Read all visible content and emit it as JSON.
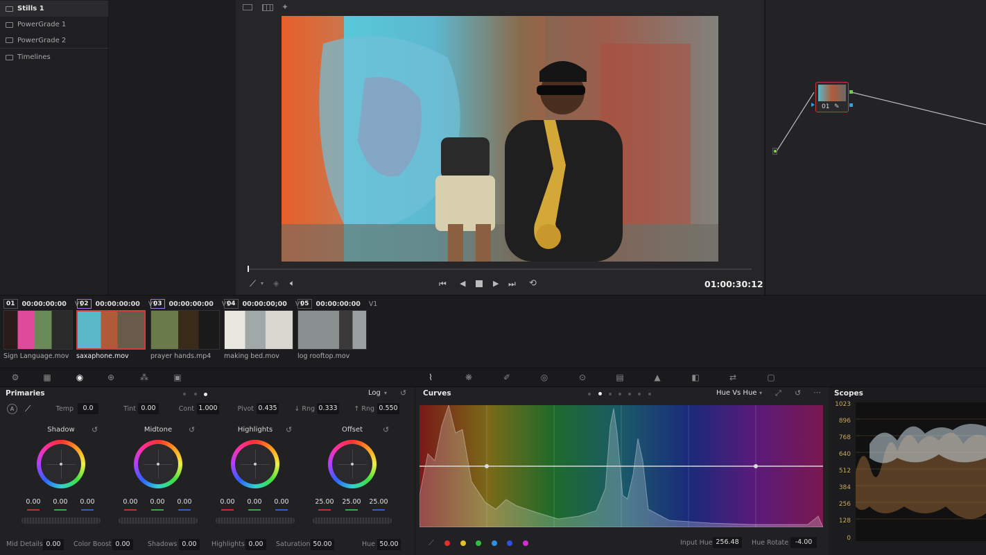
{
  "gallery": {
    "items": [
      {
        "label": "Stills 1"
      },
      {
        "label": "PowerGrade 1"
      },
      {
        "label": "PowerGrade 2"
      },
      {
        "label": "Timelines"
      }
    ]
  },
  "viewer": {
    "timecode": "01:00:30:12"
  },
  "node": {
    "label": "01"
  },
  "clips": [
    {
      "num": "01",
      "tc": "00:00:00:00",
      "track": "V1",
      "name": "Sign Language.mov",
      "color": "#cccccc"
    },
    {
      "num": "02",
      "tc": "00:00:00:00",
      "track": "V1",
      "name": "saxaphone.mov",
      "color": "#b070ff"
    },
    {
      "num": "03",
      "tc": "00:00:00:00",
      "track": "V1",
      "name": "prayer hands.mp4",
      "color": "#b070ff"
    },
    {
      "num": "04",
      "tc": "00:00:00;00",
      "track": "V1",
      "name": "making bed.mov",
      "color": "#cccccc"
    },
    {
      "num": "05",
      "tc": "00:00:00:00",
      "track": "V1",
      "name": "log rooftop.mov",
      "color": "#cccccc"
    }
  ],
  "primaries": {
    "title": "Primaries",
    "mode": "Log",
    "params": [
      {
        "label": "Temp",
        "value": "0.0"
      },
      {
        "label": "Tint",
        "value": "0.00"
      },
      {
        "label": "Cont",
        "value": "1.000"
      },
      {
        "label": "Pivot",
        "value": "0.435"
      },
      {
        "label": "↓ Rng",
        "value": "0.333"
      },
      {
        "label": "↑ Rng",
        "value": "0.550"
      }
    ],
    "wheels": [
      {
        "title": "Shadow",
        "values": [
          "0.00",
          "0.00",
          "0.00"
        ]
      },
      {
        "title": "Midtone",
        "values": [
          "0.00",
          "0.00",
          "0.00"
        ]
      },
      {
        "title": "Highlights",
        "values": [
          "0.00",
          "0.00",
          "0.00"
        ]
      },
      {
        "title": "Offset",
        "values": [
          "25.00",
          "25.00",
          "25.00"
        ]
      }
    ],
    "bottom": [
      {
        "label": "Mid Details",
        "value": "0.00"
      },
      {
        "label": "Color Boost",
        "value": "0.00"
      },
      {
        "label": "Shadows",
        "value": "0.00"
      },
      {
        "label": "Highlights",
        "value": "0.00"
      },
      {
        "label": "Saturation",
        "value": "50.00"
      },
      {
        "label": "Hue",
        "value": "50.00"
      }
    ],
    "a_label": "A"
  },
  "curves": {
    "title": "Curves",
    "mode": "Hue Vs Hue",
    "input_hue_label": "Input Hue",
    "input_hue_value": "256.48",
    "hue_rotate_label": "Hue Rotate",
    "hue_rotate_value": "-4.00",
    "swatches": [
      "#e03030",
      "#e0c030",
      "#30c040",
      "#3090e0",
      "#3050e0",
      "#d030d0"
    ]
  },
  "scopes": {
    "title": "Scopes",
    "ticks": [
      "1023",
      "896",
      "768",
      "640",
      "512",
      "384",
      "256",
      "128",
      "0"
    ]
  }
}
